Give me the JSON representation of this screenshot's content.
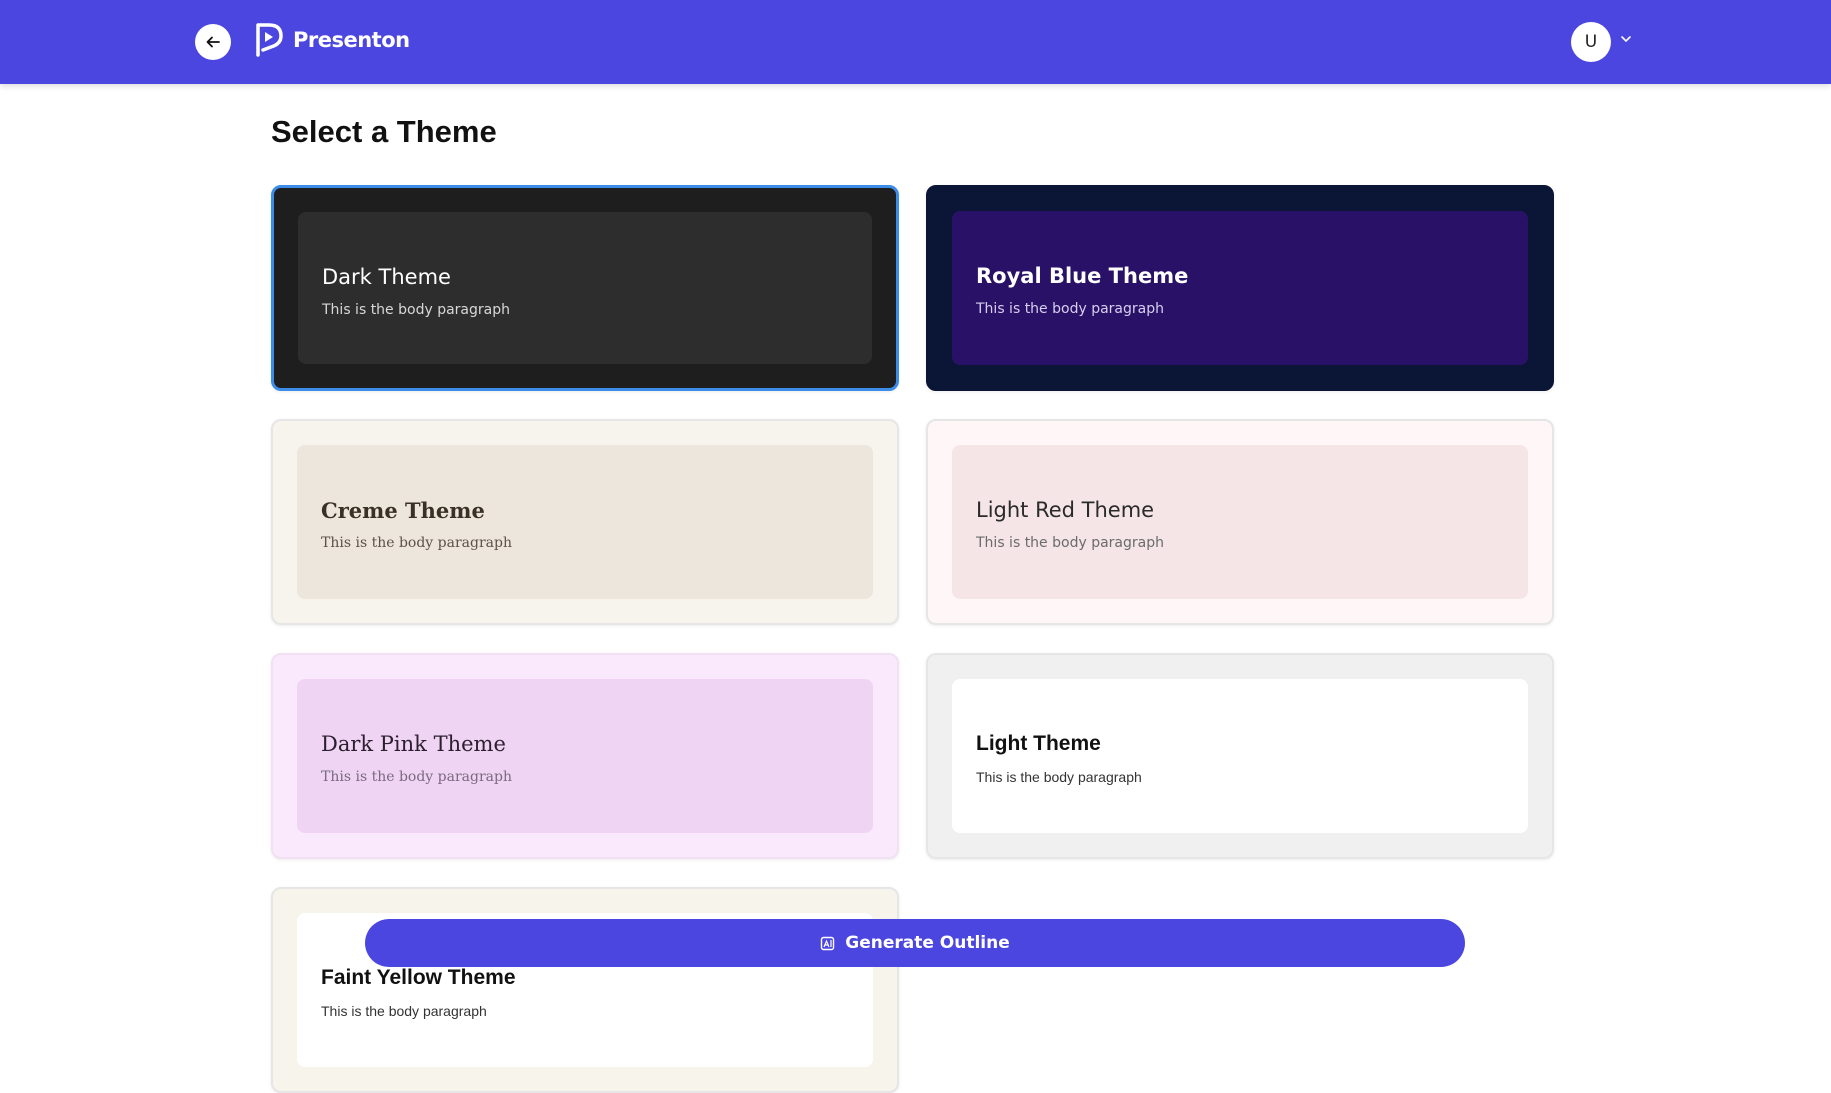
{
  "app": {
    "name": "Presenton"
  },
  "header": {
    "back_icon": "arrow-left-icon",
    "user_initial": "U",
    "user_menu_icon": "chevron-down-icon"
  },
  "page": {
    "title": "Select a Theme"
  },
  "themes": [
    {
      "name": "Dark Theme",
      "body": "This is the body paragraph",
      "selected": true,
      "outer": "#1e1e1e",
      "inner": "#2d2d2d"
    },
    {
      "name": "Royal Blue Theme",
      "body": "This is the body paragraph",
      "selected": false,
      "outer": "#0b1535",
      "inner": "#2a1168"
    },
    {
      "name": "Creme Theme",
      "body": "This is the body paragraph",
      "selected": false,
      "outer": "#f7f4ee",
      "inner": "#ede6dc"
    },
    {
      "name": "Light Red Theme",
      "body": "This is the body paragraph",
      "selected": false,
      "outer": "#fff7f7",
      "inner": "#f5e5e7"
    },
    {
      "name": "Dark Pink Theme",
      "body": "This is the body paragraph",
      "selected": false,
      "outer": "#fae9fc",
      "inner": "#f0d4f3"
    },
    {
      "name": "Light Theme",
      "body": "This is the body paragraph",
      "selected": false,
      "outer": "#f0f0f0",
      "inner": "#ffffff"
    },
    {
      "name": "Faint Yellow Theme",
      "body": "This is the body paragraph",
      "selected": false,
      "outer": "#f7f4ec",
      "inner": "#ffffff"
    }
  ],
  "actions": {
    "generate_label": "Generate Outline",
    "generate_icon": "ai-sparkle-icon"
  },
  "colors": {
    "brand": "#4c46e0",
    "selected_border": "#3b8de8"
  }
}
